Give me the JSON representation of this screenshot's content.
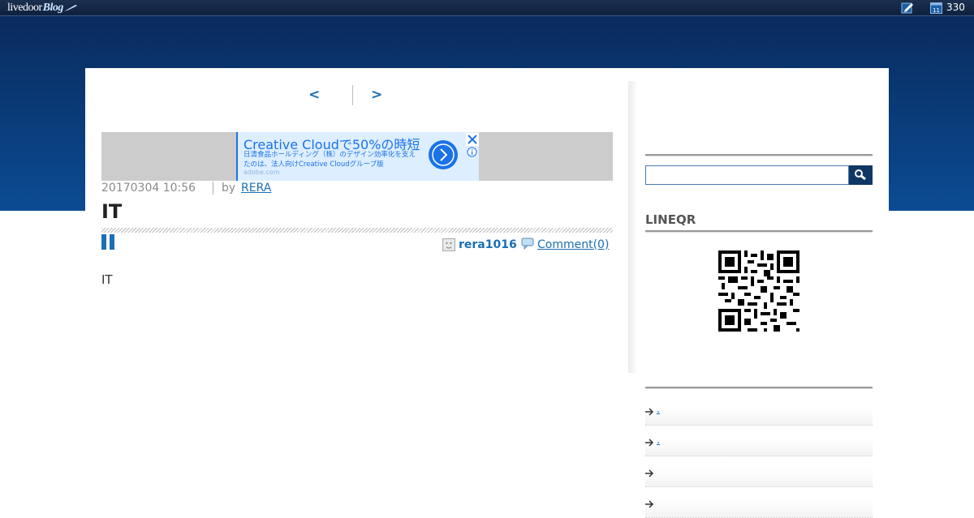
{
  "topbar": {
    "logo_text": "livedoor",
    "logo_blog": "Blog",
    "count": "330"
  },
  "pager": {
    "prev_label": "<",
    "next_label": ">"
  },
  "ad": {
    "headline": "Creative Cloudで50%の時短",
    "description": "日清食品ホールディング（株）のデザイン効率化を支えたのは、法人向けCreative Cloudグループ版",
    "url": "adobe.com"
  },
  "post": {
    "date": "20170304 10:56",
    "by_label": "by",
    "author": "RERA",
    "title": "IT",
    "user": "rera1016",
    "comment_label": "Comment(0)",
    "body": "IT"
  },
  "sidebar": {
    "search_placeholder": "",
    "lineqr_title": "LINEQR",
    "items": [
      {
        "label": "."
      },
      {
        "label": "."
      },
      {
        "label": ""
      },
      {
        "label": ""
      }
    ]
  },
  "colors": {
    "header_blue": "#0b3a78",
    "link_blue": "#1a6fb5",
    "ad_blue": "#1a73e8"
  }
}
